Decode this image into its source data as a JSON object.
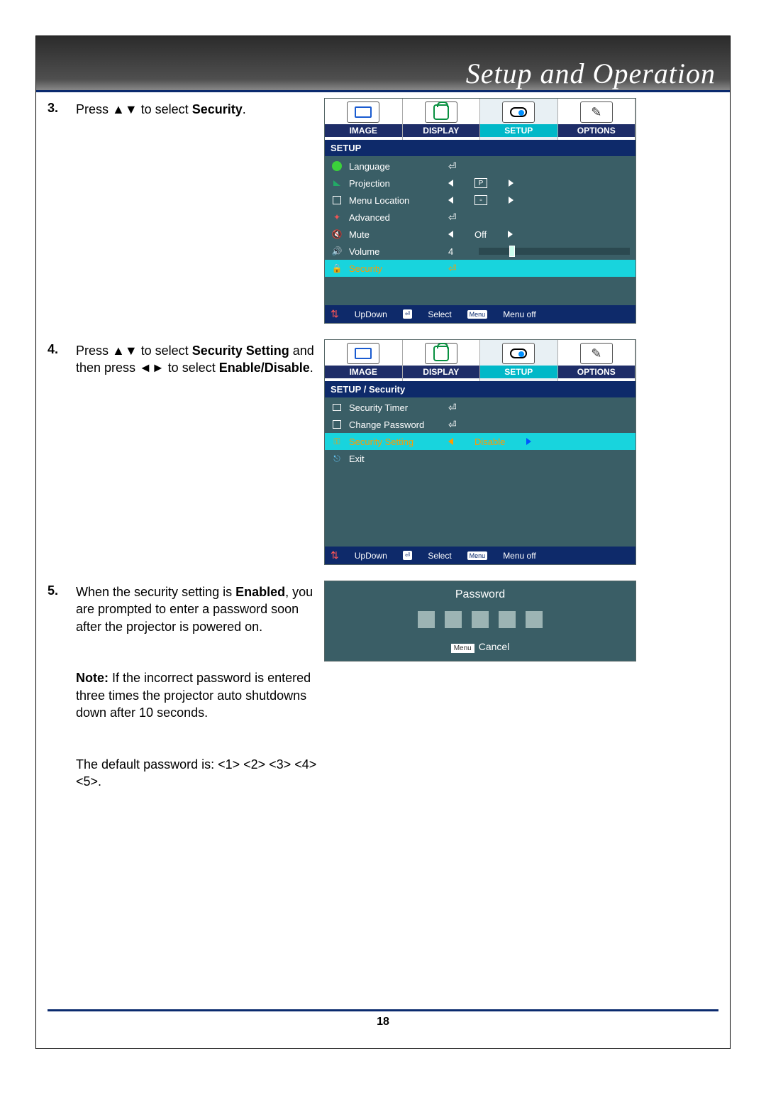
{
  "header": {
    "title": "Setup and Operation"
  },
  "steps": {
    "s3": {
      "num": "3.",
      "text_a": "Press ▲▼ to select ",
      "text_b": "Security",
      "text_c": "."
    },
    "s4": {
      "num": "4.",
      "text_a": "Press ▲▼ to select ",
      "text_b": "Security Setting",
      "text_c": " and then press ◄► to select ",
      "text_d": "Enable/Disable",
      "text_e": "."
    },
    "s5": {
      "num": "5.",
      "p1a": "When the security setting is ",
      "p1b": "Enabled",
      "p1c": ", you are prompted to enter a password soon after the projector is powered on.",
      "p2a": "Note:",
      "p2b": " If the incorrect password is entered three times the projector auto shutdowns down after 10 seconds.",
      "p3": "The default password is:  <1>  <2>  <3>  <4>  <5>."
    }
  },
  "osd": {
    "tabs": {
      "image": "IMAGE",
      "display": "DISPLAY",
      "setup": "SETUP",
      "options": "OPTIONS"
    },
    "menu1": {
      "head": "SETUP",
      "items": {
        "language": "Language",
        "projection": "Projection",
        "menulocation": "Menu Location",
        "advanced": "Advanced",
        "mute": "Mute",
        "mute_val": "Off",
        "volume": "Volume",
        "volume_val": "4",
        "security": "Security"
      }
    },
    "menu2": {
      "head": "SETUP / Security",
      "items": {
        "timer": "Security Timer",
        "changepw": "Change Password",
        "setting": "Security Setting",
        "setting_val": "Disable",
        "exit": "Exit"
      }
    },
    "foot": {
      "updown": "UpDown",
      "select": "Select",
      "menuoff": "Menu off",
      "menu_key": "Menu"
    }
  },
  "password": {
    "title": "Password",
    "cancel": "Cancel",
    "menu_key": "Menu"
  },
  "page_number": "18"
}
